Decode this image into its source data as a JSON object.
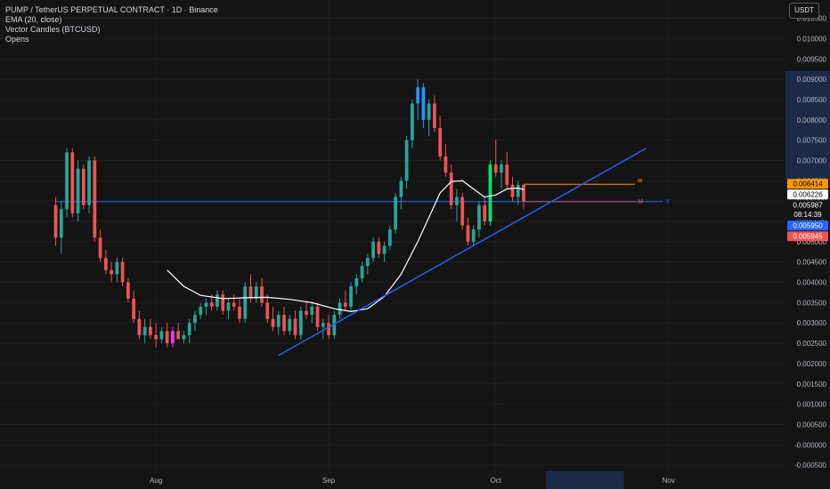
{
  "legend": {
    "title": "PUMP / TetherUS PERPETUAL CONTRACT · 1D · Binance",
    "ema": "EMA (20, close)",
    "vector": "Vector Candles (BTCUSD)",
    "opens": "Opens"
  },
  "unit_button": "USDT",
  "colors": {
    "background": "#141414",
    "up": "#26a69a",
    "down": "#ef5350",
    "ema": "#ffffff",
    "trendline": "#2962ff",
    "w_line": "#ff9800",
    "m_line": "#ef5350",
    "vector_blue": "#2196f3",
    "vector_green": "#00e676",
    "vector_magenta": "#e040fb"
  },
  "chart_data": {
    "type": "candlestick",
    "title": "PUMP / TetherUS PERPETUAL CONTRACT · 1D · Binance",
    "y_ticks": [
      "0.010500",
      "0.010000",
      "0.009500",
      "0.009000",
      "0.008500",
      "0.008000",
      "0.007500",
      "0.007000",
      "0.006500",
      "0.006000",
      "0.005500",
      "0.005000",
      "0.004500",
      "0.004000",
      "0.003500",
      "0.003000",
      "0.002500",
      "0.002000",
      "0.001500",
      "0.001000",
      "0.000500",
      "-0.000000",
      "-0.000500"
    ],
    "y_range": [
      -0.00065,
      0.01095
    ],
    "x_ticks": [
      {
        "label": "Aug",
        "date": "2025-08-01"
      },
      {
        "label": "Sep",
        "date": "2025-09-01"
      },
      {
        "label": "Oct",
        "date": "2025-10-01"
      },
      {
        "label": "Nov",
        "date": "2025-11-01"
      }
    ],
    "x_range": [
      "2025-07-04",
      "2025-11-22"
    ],
    "first_candle_date": "2025-07-14",
    "candles": [
      [
        0.0059,
        0.0061,
        0.0049,
        0.0051
      ],
      [
        0.0051,
        0.006,
        0.0047,
        0.0058
      ],
      [
        0.0058,
        0.0073,
        0.0056,
        0.0072
      ],
      [
        0.0072,
        0.0073,
        0.0056,
        0.0057
      ],
      [
        0.0057,
        0.007,
        0.0055,
        0.0068
      ],
      [
        0.0068,
        0.0069,
        0.0058,
        0.0059
      ],
      [
        0.0059,
        0.0071,
        0.0057,
        0.007
      ],
      [
        0.007,
        0.0071,
        0.005,
        0.0051
      ],
      [
        0.0051,
        0.0053,
        0.0045,
        0.0046
      ],
      [
        0.0046,
        0.0048,
        0.0042,
        0.0043
      ],
      [
        0.0043,
        0.0045,
        0.004,
        0.0042
      ],
      [
        0.0042,
        0.0046,
        0.004,
        0.0045
      ],
      [
        0.0045,
        0.0046,
        0.0039,
        0.004
      ],
      [
        0.004,
        0.0041,
        0.0035,
        0.0036
      ],
      [
        0.0036,
        0.0038,
        0.003,
        0.0031
      ],
      [
        0.0031,
        0.0033,
        0.0026,
        0.0027
      ],
      [
        0.0027,
        0.0031,
        0.0025,
        0.0029
      ],
      [
        0.0029,
        0.0031,
        0.0026,
        0.0027
      ],
      [
        0.0027,
        0.003,
        0.0024,
        0.0026
      ],
      [
        0.0026,
        0.0029,
        0.0025,
        0.0028
      ],
      [
        0.0028,
        0.003,
        0.0024,
        0.0025
      ],
      [
        0.0025,
        0.0029,
        0.0024,
        0.0028
      ],
      [
        0.0028,
        0.003,
        0.0026,
        0.0026
      ],
      [
        0.0026,
        0.0028,
        0.0025,
        0.0027
      ],
      [
        0.0027,
        0.0031,
        0.0025,
        0.003
      ],
      [
        0.003,
        0.0033,
        0.0028,
        0.0032
      ],
      [
        0.0032,
        0.0035,
        0.0031,
        0.0034
      ],
      [
        0.0034,
        0.0036,
        0.0032,
        0.0035
      ],
      [
        0.0035,
        0.0037,
        0.0033,
        0.0034
      ],
      [
        0.0034,
        0.0038,
        0.0033,
        0.0037
      ],
      [
        0.0037,
        0.0038,
        0.0032,
        0.0033
      ],
      [
        0.0033,
        0.0036,
        0.0031,
        0.0035
      ],
      [
        0.0035,
        0.0037,
        0.0033,
        0.0034
      ],
      [
        0.0034,
        0.0036,
        0.003,
        0.0031
      ],
      [
        0.0031,
        0.004,
        0.003,
        0.0039
      ],
      [
        0.0039,
        0.0042,
        0.0035,
        0.0036
      ],
      [
        0.0036,
        0.004,
        0.0035,
        0.0039
      ],
      [
        0.0039,
        0.0041,
        0.0034,
        0.0035
      ],
      [
        0.0035,
        0.0037,
        0.003,
        0.0031
      ],
      [
        0.0031,
        0.0034,
        0.0028,
        0.0029
      ],
      [
        0.0029,
        0.0033,
        0.0027,
        0.0032
      ],
      [
        0.0032,
        0.0034,
        0.0027,
        0.0028
      ],
      [
        0.0028,
        0.0032,
        0.0027,
        0.0031
      ],
      [
        0.0031,
        0.0033,
        0.0026,
        0.0027
      ],
      [
        0.0027,
        0.0034,
        0.0026,
        0.0033
      ],
      [
        0.0033,
        0.0035,
        0.0031,
        0.0032
      ],
      [
        0.0032,
        0.0035,
        0.003,
        0.0034
      ],
      [
        0.0034,
        0.0035,
        0.0028,
        0.0029
      ],
      [
        0.0029,
        0.0031,
        0.0026,
        0.003
      ],
      [
        0.003,
        0.0032,
        0.0026,
        0.0027
      ],
      [
        0.0027,
        0.0033,
        0.0026,
        0.0032
      ],
      [
        0.0032,
        0.0036,
        0.0031,
        0.0035
      ],
      [
        0.0035,
        0.0038,
        0.0033,
        0.0034
      ],
      [
        0.0034,
        0.004,
        0.0033,
        0.0039
      ],
      [
        0.0039,
        0.0042,
        0.0037,
        0.0041
      ],
      [
        0.0041,
        0.0045,
        0.004,
        0.0044
      ],
      [
        0.0044,
        0.0047,
        0.0042,
        0.0046
      ],
      [
        0.0046,
        0.0051,
        0.0045,
        0.005
      ],
      [
        0.005,
        0.0051,
        0.0046,
        0.0047
      ],
      [
        0.0047,
        0.005,
        0.0045,
        0.0049
      ],
      [
        0.0049,
        0.0054,
        0.0048,
        0.0053
      ],
      [
        0.0053,
        0.0062,
        0.0052,
        0.0061
      ],
      [
        0.0061,
        0.0066,
        0.0058,
        0.0065
      ],
      [
        0.0065,
        0.0076,
        0.0063,
        0.0075
      ],
      [
        0.0075,
        0.0085,
        0.0073,
        0.0084
      ],
      [
        0.0084,
        0.009,
        0.008,
        0.0088
      ],
      [
        0.0088,
        0.0089,
        0.0078,
        0.008
      ],
      [
        0.008,
        0.0085,
        0.0076,
        0.0084
      ],
      [
        0.0084,
        0.0086,
        0.0077,
        0.0078
      ],
      [
        0.0078,
        0.0081,
        0.007,
        0.0071
      ],
      [
        0.0071,
        0.0074,
        0.0066,
        0.0067
      ],
      [
        0.0067,
        0.0069,
        0.0058,
        0.0059
      ],
      [
        0.0059,
        0.0063,
        0.0055,
        0.0061
      ],
      [
        0.0061,
        0.0062,
        0.0053,
        0.0054
      ],
      [
        0.0054,
        0.0056,
        0.0049,
        0.005
      ],
      [
        0.005,
        0.0054,
        0.0049,
        0.0053
      ],
      [
        0.0053,
        0.006,
        0.0051,
        0.0059
      ],
      [
        0.0059,
        0.0061,
        0.0054,
        0.0055
      ],
      [
        0.0055,
        0.007,
        0.0054,
        0.0069
      ],
      [
        0.0069,
        0.0075,
        0.0066,
        0.0067
      ],
      [
        0.0067,
        0.007,
        0.0063,
        0.0069
      ],
      [
        0.0069,
        0.0072,
        0.0063,
        0.0064
      ],
      [
        0.0064,
        0.0066,
        0.006,
        0.0061
      ],
      [
        0.0061,
        0.0065,
        0.0059,
        0.0064
      ],
      [
        0.0064,
        0.0064,
        0.0058,
        0.006
      ]
    ],
    "vector_candles": [
      {
        "index": 21,
        "color": "magenta"
      },
      {
        "index": 65,
        "color": "blue"
      },
      {
        "index": 66,
        "color": "blue"
      },
      {
        "index": 78,
        "color": "green"
      }
    ],
    "ema": [
      {
        "index": 20,
        "value": 0.0043
      },
      {
        "index": 23,
        "value": 0.0039
      },
      {
        "index": 26,
        "value": 0.00368
      },
      {
        "index": 30,
        "value": 0.0036
      },
      {
        "index": 34,
        "value": 0.00362
      },
      {
        "index": 38,
        "value": 0.00363
      },
      {
        "index": 42,
        "value": 0.00358
      },
      {
        "index": 46,
        "value": 0.0035
      },
      {
        "index": 50,
        "value": 0.00335
      },
      {
        "index": 53,
        "value": 0.00328
      },
      {
        "index": 56,
        "value": 0.00335
      },
      {
        "index": 59,
        "value": 0.00365
      },
      {
        "index": 62,
        "value": 0.0042
      },
      {
        "index": 65,
        "value": 0.005
      },
      {
        "index": 67,
        "value": 0.0056
      },
      {
        "index": 69,
        "value": 0.0062
      },
      {
        "index": 71,
        "value": 0.00648
      },
      {
        "index": 73,
        "value": 0.0065
      },
      {
        "index": 75,
        "value": 0.0063
      },
      {
        "index": 77,
        "value": 0.0061
      },
      {
        "index": 79,
        "value": 0.00615
      },
      {
        "index": 81,
        "value": 0.0063
      },
      {
        "index": 83,
        "value": 0.00632
      },
      {
        "index": 84,
        "value": 0.00628
      }
    ],
    "trendline": {
      "start": {
        "date": "2025-08-23",
        "value": 0.0022
      },
      "end": {
        "date": "2025-10-28",
        "value": 0.0073
      }
    },
    "levels": [
      {
        "name": "horizontal",
        "value": 0.005987,
        "from": "2025-07-14",
        "to": "2025-10-31",
        "label": "X"
      },
      {
        "name": "w",
        "value": 0.006414,
        "from": "2025-10-06",
        "to": "2025-10-26",
        "label": "w"
      },
      {
        "name": "m",
        "value": 0.005987,
        "from": "2025-10-06",
        "to": "2025-10-26",
        "label": "M"
      }
    ],
    "price_labels": [
      {
        "text": "0.006414",
        "value": 0.006414,
        "bg": "#ff9800",
        "fg": "#000000"
      },
      {
        "text": "0.006226",
        "value": 0.006226,
        "bg": "#ffffff",
        "fg": "#000000"
      },
      {
        "text": "0.005987",
        "value": 0.005987,
        "bg": "#141414",
        "fg": "#ffffff",
        "sub": "08:14:39"
      },
      {
        "text": "0.005950",
        "value": 0.00595,
        "bg": "#2962ff",
        "fg": "#ffffff"
      },
      {
        "text": "0.005945",
        "value": 0.005945,
        "bg": "#ef5350",
        "fg": "#ffffff"
      }
    ],
    "highlight_x": [
      "2025-10-10",
      "2025-10-24"
    ],
    "highlight_y": [
      0.0065,
      0.0092
    ]
  }
}
